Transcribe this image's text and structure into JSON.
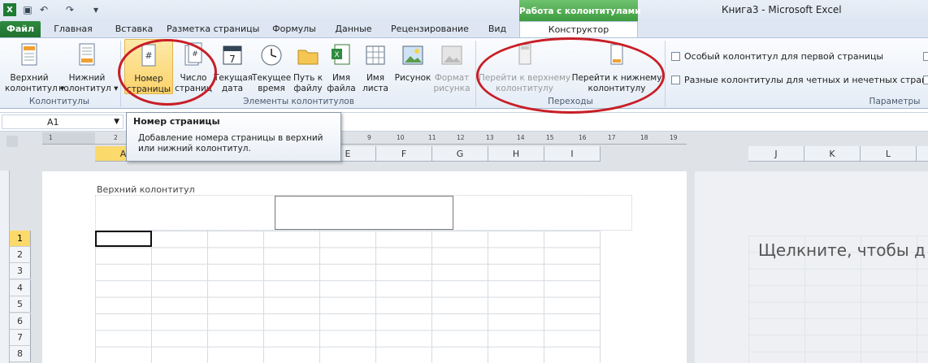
{
  "window": {
    "title": "Книга3 - Microsoft Excel"
  },
  "context_tab_group": "Работа с колонтитулами",
  "tabs": {
    "file": "Файл",
    "home": "Главная",
    "insert": "Вставка",
    "page_layout": "Разметка страницы",
    "formulas": "Формулы",
    "data": "Данные",
    "review": "Рецензирование",
    "view": "Вид",
    "designer": "Конструктор"
  },
  "ribbon": {
    "header_label": "Верхний колонтитул",
    "footer_label": "Нижний колонтитул",
    "header_l1": "Верхний",
    "header_l2": "колонтитул",
    "footer_l1": "Нижний",
    "footer_l2": "колонтитул",
    "page_num_l1": "Номер",
    "page_num_l2": "страницы",
    "page_count_l1": "Число",
    "page_count_l2": "страниц",
    "date_l1": "Текущая",
    "date_l2": "дата",
    "time_l1": "Текущее",
    "time_l2": "время",
    "path_l1": "Путь к",
    "path_l2": "файлу",
    "filename_l1": "Имя",
    "filename_l2": "файла",
    "sheetname_l1": "Имя",
    "sheetname_l2": "листа",
    "picture_l1": "Рисунок",
    "format_l1": "Формат",
    "format_l2": "рисунка",
    "goto_header_l1": "Перейти к верхнему",
    "goto_header_l2": "колонтитулу",
    "goto_footer_l1": "Перейти к нижнему",
    "goto_footer_l2": "колонтитулу",
    "group_hf": "Колонтитулы",
    "group_elements": "Элементы колонтитулов",
    "group_nav": "Переходы",
    "group_params": "Параметры",
    "opt_first_page": "Особый колонтитул для первой страницы",
    "opt_odd_even": "Разные колонтитулы для четных и нечетных страниц"
  },
  "namebox": "A1",
  "tooltip": {
    "title": "Номер страницы",
    "text_l1": "Добавление номера страницы в верхний",
    "text_l2": "или нижний колонтитул."
  },
  "ruler_ticks": [
    "1",
    "2",
    "3",
    "9",
    "10",
    "11",
    "12",
    "13",
    "14",
    "15",
    "16",
    "17",
    "18",
    "19"
  ],
  "columns_left": [
    "A",
    "E",
    "F",
    "G",
    "H",
    "I"
  ],
  "columns_right": [
    "J",
    "K",
    "L"
  ],
  "rows": [
    "1",
    "2",
    "3",
    "4",
    "5",
    "6",
    "7",
    "8"
  ],
  "page_header_label": "Верхний колонтитул",
  "right_page_text": "Щелкните, чтобы д",
  "colors": {
    "accent_green": "#3e9b3e",
    "highlight_circle": "#c81e26",
    "selected_header": "#fbd96a"
  }
}
